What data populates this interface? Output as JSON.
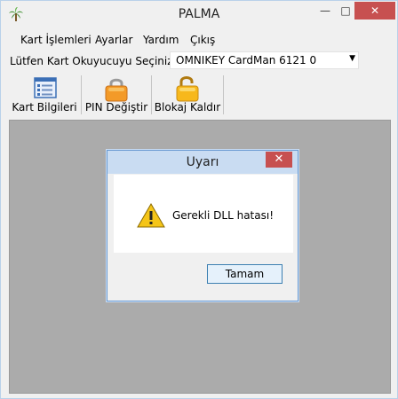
{
  "window": {
    "title": "PALMA",
    "app_icon": "palm-tree-icon",
    "controls": {
      "minimize": "—",
      "maximize": "□",
      "close": "✕"
    }
  },
  "menu": {
    "items": [
      {
        "label": "Kart İşlemleri"
      },
      {
        "label": "Ayarlar"
      },
      {
        "label": "Yardım"
      },
      {
        "label": "Çıkış"
      }
    ]
  },
  "reader": {
    "label": "Lütfen Kart Okuyucuyu Seçiniz :",
    "selected": "OMNIKEY CardMan 6121 0"
  },
  "toolbar": {
    "buttons": [
      {
        "label": "Kart Bilgileri",
        "icon": "card-info-icon"
      },
      {
        "label": "PIN Değiştir",
        "icon": "lock-icon"
      },
      {
        "label": "Blokaj Kaldır",
        "icon": "unlock-icon"
      }
    ]
  },
  "dialog": {
    "title": "Uyarı",
    "message": "Gerekli DLL hatası!",
    "ok_label": "Tamam",
    "close_symbol": "✕",
    "icon": "warning-icon"
  },
  "colors": {
    "client_bg": "#ababab",
    "close_red": "#c75050",
    "dialog_titlebar": "#c9dcf2",
    "button_border": "#3c7fb1"
  }
}
